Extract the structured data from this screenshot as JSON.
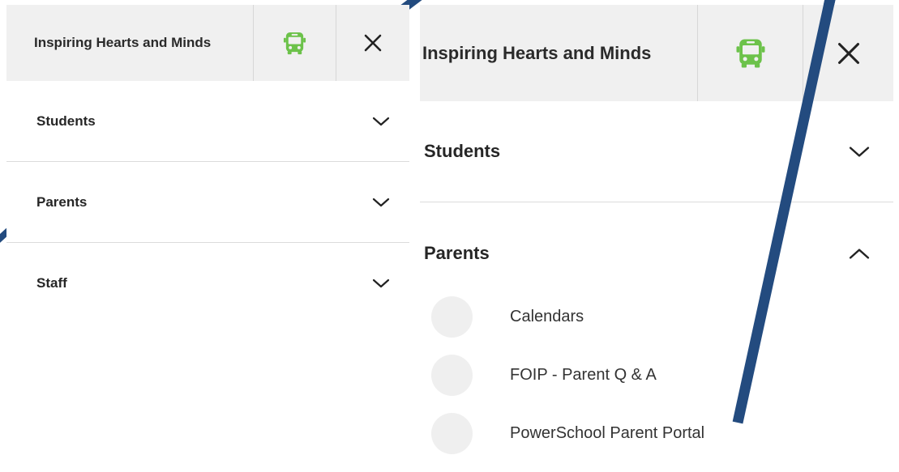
{
  "colors": {
    "header_bg": "#f0f0f0",
    "bus_icon": "#6cc24a",
    "annotation_line": "#234b7f",
    "divider": "#dcdcdc",
    "sub_circle": "#efefef"
  },
  "icons": {
    "bus": "school-bus-icon",
    "close": "close-icon",
    "collapsed": "chevron-down-icon",
    "expanded": "chevron-up-icon"
  },
  "left_panel": {
    "title": "Inspiring Hearts and Minds",
    "menu": [
      {
        "label": "Students",
        "state": "collapsed"
      },
      {
        "label": "Parents",
        "state": "collapsed"
      },
      {
        "label": "Staff",
        "state": "collapsed"
      }
    ]
  },
  "right_panel": {
    "title": "Inspiring Hearts and Minds",
    "menu": [
      {
        "label": "Students",
        "state": "collapsed"
      },
      {
        "label": "Parents",
        "state": "expanded"
      }
    ],
    "parents_submenu": [
      {
        "label": "Calendars"
      },
      {
        "label": "FOIP - Parent Q & A"
      },
      {
        "label": "PowerSchool Parent Portal"
      }
    ]
  }
}
